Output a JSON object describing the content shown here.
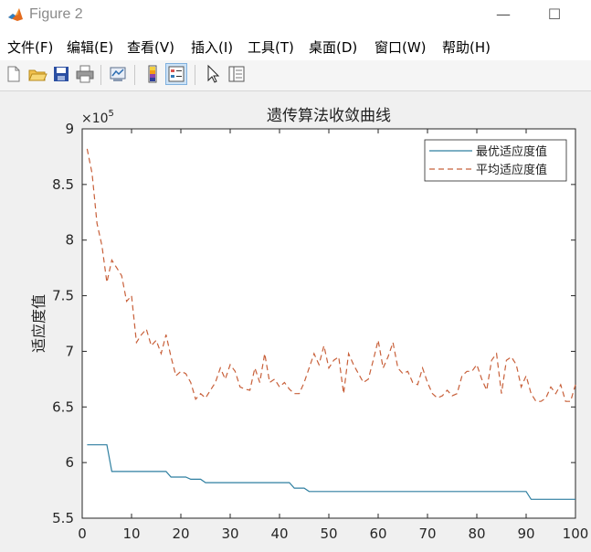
{
  "window": {
    "title": "Figure 2",
    "minimize_glyph": "—",
    "maximize_glyph": "☐"
  },
  "menu": [
    "文件(F)",
    "编辑(E)",
    "查看(V)",
    "插入(I)",
    "工具(T)",
    "桌面(D)",
    "窗口(W)",
    "帮助(H)"
  ],
  "toolbar_icons": [
    "new-figure-icon",
    "open-file-icon",
    "save-icon",
    "print-icon",
    "link-plot-icon",
    "insert-colorbar-icon",
    "insert-legend-icon",
    "pointer-icon",
    "property-inspector-icon"
  ],
  "colors": {
    "best": "#2e7fa0",
    "avg": "#c8603a"
  },
  "chart_data": {
    "type": "line",
    "title": "遗传算法收敛曲线",
    "xlabel": "",
    "ylabel": "适应度值",
    "y_exponent_label": "×10",
    "y_exponent_power": "5",
    "xlim": [
      0,
      100
    ],
    "ylim": [
      5.5,
      9
    ],
    "xticks": [
      0,
      10,
      20,
      30,
      40,
      50,
      60,
      70,
      80,
      90,
      100
    ],
    "yticks": [
      5.5,
      6,
      6.5,
      7,
      7.5,
      8,
      8.5,
      9
    ],
    "legend_position": "top-right",
    "series": [
      {
        "name": "最优适应度值",
        "style": "solid",
        "x": [
          1,
          2,
          3,
          4,
          5,
          6,
          7,
          8,
          9,
          10,
          11,
          12,
          13,
          14,
          15,
          16,
          17,
          18,
          19,
          20,
          21,
          22,
          23,
          24,
          25,
          26,
          27,
          28,
          29,
          30,
          31,
          32,
          33,
          34,
          35,
          36,
          37,
          38,
          39,
          40,
          41,
          42,
          43,
          44,
          45,
          46,
          47,
          48,
          49,
          50,
          51,
          52,
          53,
          54,
          55,
          56,
          57,
          58,
          59,
          60,
          61,
          62,
          63,
          64,
          65,
          66,
          67,
          68,
          69,
          70,
          71,
          72,
          73,
          74,
          75,
          76,
          77,
          78,
          79,
          80,
          81,
          82,
          83,
          84,
          85,
          86,
          87,
          88,
          89,
          90,
          91,
          92,
          93,
          94,
          95,
          96,
          97,
          98,
          99,
          100
        ],
        "values": [
          6.16,
          6.16,
          6.16,
          6.16,
          6.16,
          5.92,
          5.92,
          5.92,
          5.92,
          5.92,
          5.92,
          5.92,
          5.92,
          5.92,
          5.92,
          5.92,
          5.92,
          5.87,
          5.87,
          5.87,
          5.87,
          5.85,
          5.85,
          5.85,
          5.82,
          5.82,
          5.82,
          5.82,
          5.82,
          5.82,
          5.82,
          5.82,
          5.82,
          5.82,
          5.82,
          5.82,
          5.82,
          5.82,
          5.82,
          5.82,
          5.82,
          5.82,
          5.77,
          5.77,
          5.77,
          5.74,
          5.74,
          5.74,
          5.74,
          5.74,
          5.74,
          5.74,
          5.74,
          5.74,
          5.74,
          5.74,
          5.74,
          5.74,
          5.74,
          5.74,
          5.74,
          5.74,
          5.74,
          5.74,
          5.74,
          5.74,
          5.74,
          5.74,
          5.74,
          5.74,
          5.74,
          5.74,
          5.74,
          5.74,
          5.74,
          5.74,
          5.74,
          5.74,
          5.74,
          5.74,
          5.74,
          5.74,
          5.74,
          5.74,
          5.74,
          5.74,
          5.74,
          5.74,
          5.74,
          5.74,
          5.67,
          5.67,
          5.67,
          5.67,
          5.67,
          5.67,
          5.67,
          5.67,
          5.67,
          5.67
        ]
      },
      {
        "name": "平均适应度值",
        "style": "dashed",
        "x": [
          1,
          2,
          3,
          4,
          5,
          6,
          7,
          8,
          9,
          10,
          11,
          12,
          13,
          14,
          15,
          16,
          17,
          18,
          19,
          20,
          21,
          22,
          23,
          24,
          25,
          26,
          27,
          28,
          29,
          30,
          31,
          32,
          33,
          34,
          35,
          36,
          37,
          38,
          39,
          40,
          41,
          42,
          43,
          44,
          45,
          46,
          47,
          48,
          49,
          50,
          51,
          52,
          53,
          54,
          55,
          56,
          57,
          58,
          59,
          60,
          61,
          62,
          63,
          64,
          65,
          66,
          67,
          68,
          69,
          70,
          71,
          72,
          73,
          74,
          75,
          76,
          77,
          78,
          79,
          80,
          81,
          82,
          83,
          84,
          85,
          86,
          87,
          88,
          89,
          90,
          91,
          92,
          93,
          94,
          95,
          96,
          97,
          98,
          99,
          100
        ],
        "values": [
          8.82,
          8.6,
          8.15,
          7.95,
          7.62,
          7.82,
          7.75,
          7.68,
          7.45,
          7.5,
          7.08,
          7.15,
          7.2,
          7.05,
          7.1,
          6.98,
          7.15,
          6.95,
          6.78,
          6.82,
          6.8,
          6.72,
          6.57,
          6.62,
          6.58,
          6.65,
          6.72,
          6.85,
          6.75,
          6.88,
          6.82,
          6.68,
          6.66,
          6.65,
          6.85,
          6.72,
          6.98,
          6.72,
          6.75,
          6.68,
          6.72,
          6.66,
          6.62,
          6.62,
          6.72,
          6.85,
          6.98,
          6.88,
          7.05,
          6.85,
          6.92,
          6.95,
          6.62,
          6.98,
          6.88,
          6.8,
          6.72,
          6.75,
          6.92,
          7.1,
          6.85,
          6.95,
          7.08,
          6.85,
          6.8,
          6.82,
          6.72,
          6.7,
          6.85,
          6.72,
          6.62,
          6.58,
          6.6,
          6.65,
          6.6,
          6.62,
          6.78,
          6.82,
          6.82,
          6.88,
          6.75,
          6.65,
          6.92,
          6.98,
          6.62,
          6.92,
          6.95,
          6.88,
          6.68,
          6.78,
          6.62,
          6.55,
          6.55,
          6.58,
          6.68,
          6.62,
          6.7,
          6.55,
          6.55,
          6.7
        ]
      }
    ]
  }
}
